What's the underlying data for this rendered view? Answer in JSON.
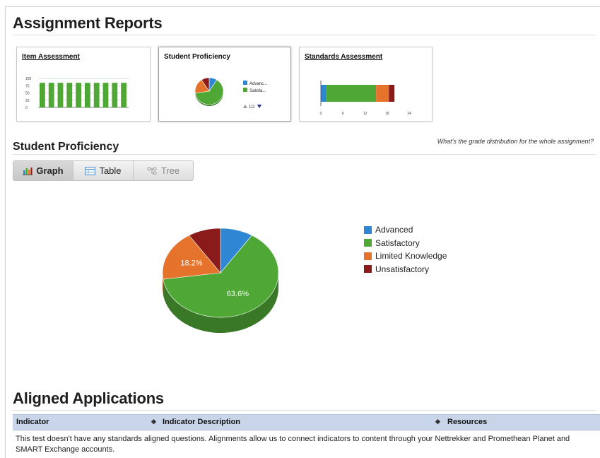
{
  "reports": {
    "title": "Assignment Reports",
    "cards": {
      "item_assessment": {
        "title": "Item Assessment",
        "y_ticks": [
          "100",
          "75",
          "50",
          "25",
          "0"
        ],
        "bars": [
          85,
          85,
          85,
          85,
          85,
          85,
          85,
          85,
          85,
          85
        ]
      },
      "student_proficiency": {
        "title": "Student Proficiency",
        "legend": [
          "Advanc...",
          "Satisfa..."
        ],
        "pager": "1/2"
      },
      "standards_assessment": {
        "title": "Standards Assessment",
        "x_ticks": [
          "0",
          "6",
          "12",
          "18",
          "24"
        ],
        "segments": [
          {
            "value": 1.5,
            "color": "#2f86d2"
          },
          {
            "value": 13.5,
            "color": "#4fa736"
          },
          {
            "value": 3.5,
            "color": "#e5732c"
          },
          {
            "value": 1.5,
            "color": "#8b1a1a"
          }
        ]
      }
    }
  },
  "proficiency": {
    "title": "Student Proficiency",
    "question": "What's the grade distribution for the whole assignment?",
    "tabs": [
      {
        "label": "Graph",
        "active": true
      },
      {
        "label": "Table",
        "active": false
      },
      {
        "label": "Tree",
        "active": false
      }
    ]
  },
  "chart_data": {
    "type": "pie",
    "labels": [
      "Advanced",
      "Satisfactory",
      "Limited Knowledge",
      "Unsatisfactory"
    ],
    "values": [
      9.1,
      63.6,
      18.2,
      9.1
    ],
    "slice_labels": [
      "",
      "63.6%",
      "18.2%",
      ""
    ],
    "colors": [
      "#2f86d2",
      "#4fa736",
      "#e5732c",
      "#8b1a1a"
    ],
    "legend_position": "right"
  },
  "aligned": {
    "title": "Aligned Applications",
    "columns": [
      "Indicator",
      "Indicator Description",
      "Resources"
    ],
    "message": "This test doesn't have any standards aligned questions. Alignments allow us to connect indicators to content through your Nettrekker and Promethean Planet and SMART Exchange accounts."
  }
}
